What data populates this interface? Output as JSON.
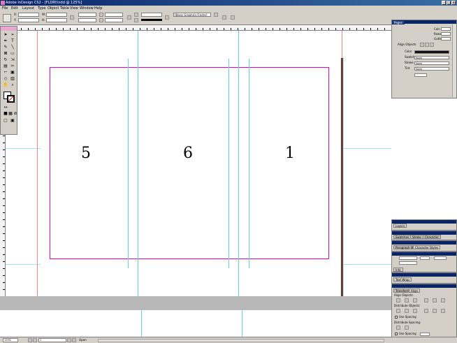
{
  "window": {
    "title": "Adobe InDesign CS2 - [FLDRY.indd @ 125%]",
    "controls": [
      "_",
      "□",
      "x"
    ]
  },
  "menubar": {
    "items": [
      "File",
      "Edit",
      "Layout",
      "Type",
      "Object",
      "Table",
      "View",
      "Window",
      "Help"
    ]
  },
  "controlbar": {
    "x_label": "X:",
    "y_label": "Y:",
    "w_label": "W:",
    "h_label": "H:",
    "stroke_style_value": "[Basic Graphics Frame]",
    "icons": [
      "reference-point-icon",
      "constrain-icon",
      "rotate-icon",
      "shear-icon",
      "flip-icon",
      "stroke-icon",
      "fill-icon"
    ]
  },
  "pages": {
    "left_numbers": [
      "5",
      "6"
    ],
    "right_number": "1"
  },
  "tools": {
    "items": [
      "selection-tool",
      "direct-selection-tool",
      "pen-tool",
      "type-tool",
      "pencil-tool",
      "line-tool",
      "rectangle-frame-tool",
      "rectangle-tool",
      "rotate-tool",
      "scale-tool",
      "gradient-tool",
      "scissors-tool",
      "hand-tool",
      "zoom-tool",
      "fill-swatch",
      "stroke-swatch",
      "normal-view",
      "preview-view"
    ]
  },
  "panel_top": {
    "tab": "Pages",
    "rows": [
      {
        "label": "Cols",
        "value": ""
      },
      {
        "label": "Rows",
        "value": ""
      },
      {
        "label": "Gutter",
        "value": ""
      }
    ],
    "align_title": "Align Objects",
    "fields": [
      {
        "label": "Color",
        "value": ""
      },
      {
        "label": "Swatch",
        "value": "None"
      },
      {
        "label": "Stroke",
        "value": "None"
      },
      {
        "label": "Tint",
        "value": "None"
      }
    ]
  },
  "panel_mid1": {
    "tab": "Layers"
  },
  "panel_mid2": {
    "tabs": [
      "Swatches",
      "Stroke",
      "Character"
    ]
  },
  "panel_mid3": {
    "tabs": [
      "Paragraph Styles",
      "Character Styles"
    ]
  },
  "panel_mid4": {
    "tab": "Info"
  },
  "panel_mid5": {
    "tab": "Text Wrap"
  },
  "panel_bottom": {
    "tabs": [
      "Transform",
      "Align"
    ],
    "sections": [
      "Align Objects:",
      "Distribute Objects:",
      "Distribute Spacing:"
    ],
    "checkboxes": [
      "Use Spacing",
      "Use Spacing"
    ]
  },
  "statusbar": {
    "zoom": "125%",
    "page": "1",
    "status": "Open"
  },
  "colors": {
    "margin_guides": "#e600c8",
    "column_guides": "#5ad6e6",
    "bleed_guides": "#ff8080",
    "title_bar": "#0a246a",
    "chrome": "#d4d0c8"
  }
}
